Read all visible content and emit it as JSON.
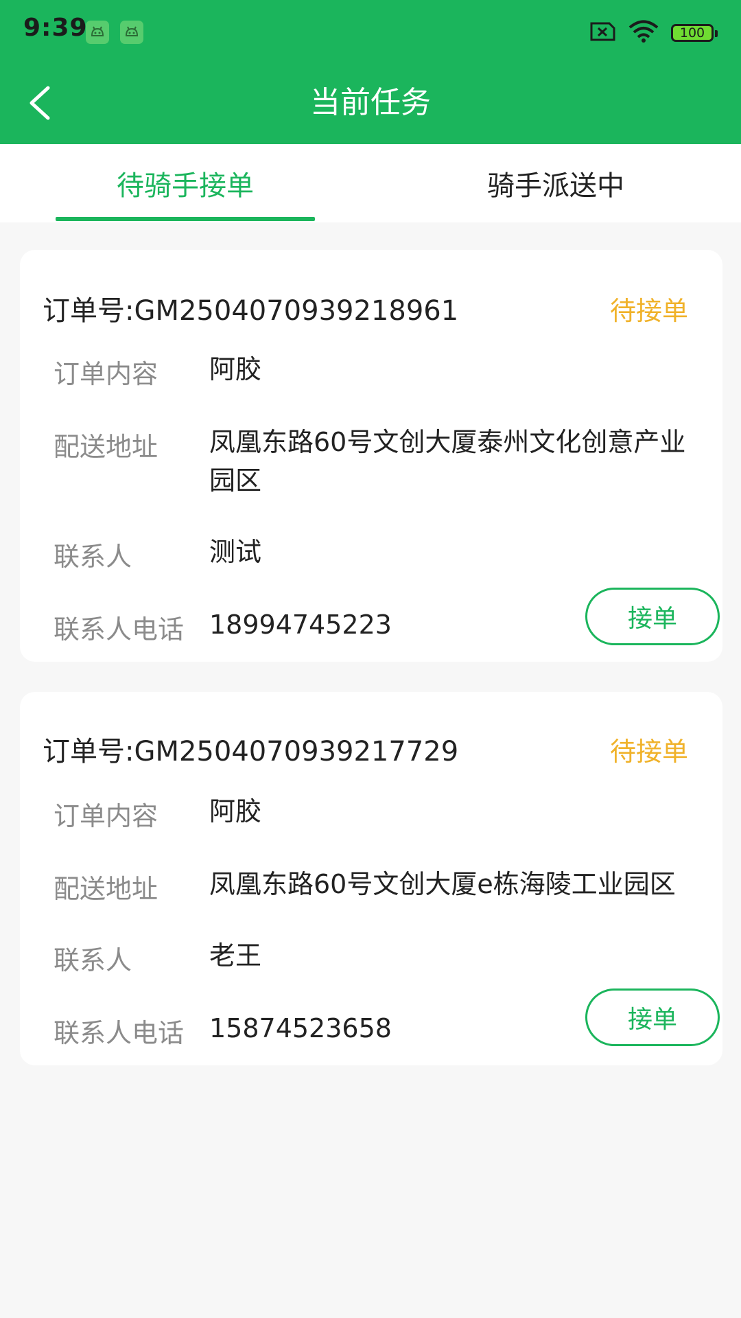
{
  "status_bar": {
    "time": "9:39",
    "battery": "100",
    "app_icons": [
      "android-app-icon",
      "android-app-icon"
    ],
    "right_icons": [
      "sim-error-icon",
      "wifi-icon",
      "battery-icon"
    ]
  },
  "header": {
    "title": "当前任务",
    "back_icon": "chevron-left-icon"
  },
  "tabs": [
    {
      "label": "待骑手接单",
      "active": true
    },
    {
      "label": "骑手派送中",
      "active": false
    }
  ],
  "orders": [
    {
      "order_no": "订单号:GM2504070939218961",
      "status": "待接单",
      "fields": [
        {
          "label": "订单内容",
          "value": "阿胶"
        },
        {
          "label": "配送地址",
          "value": "凤凰东路60号文创大厦泰州文化创意产业园区"
        },
        {
          "label": "联系人",
          "value": "测试"
        },
        {
          "label": "联系人电话",
          "value": "18994745223"
        }
      ],
      "action": "接单"
    },
    {
      "order_no": "订单号:GM2504070939217729",
      "status": "待接单",
      "fields": [
        {
          "label": "订单内容",
          "value": "阿胶"
        },
        {
          "label": "配送地址",
          "value": "凤凰东路60号文创大厦e栋海陵工业园区"
        },
        {
          "label": "联系人",
          "value": "老王"
        },
        {
          "label": "联系人电话",
          "value": "15874523658"
        }
      ],
      "action": "接单"
    }
  ],
  "colors": {
    "primary": "#1bb55c",
    "status_pending": "#f0b22a",
    "label": "#8b8b8b",
    "text": "#222222",
    "background": "#f7f7f7"
  }
}
